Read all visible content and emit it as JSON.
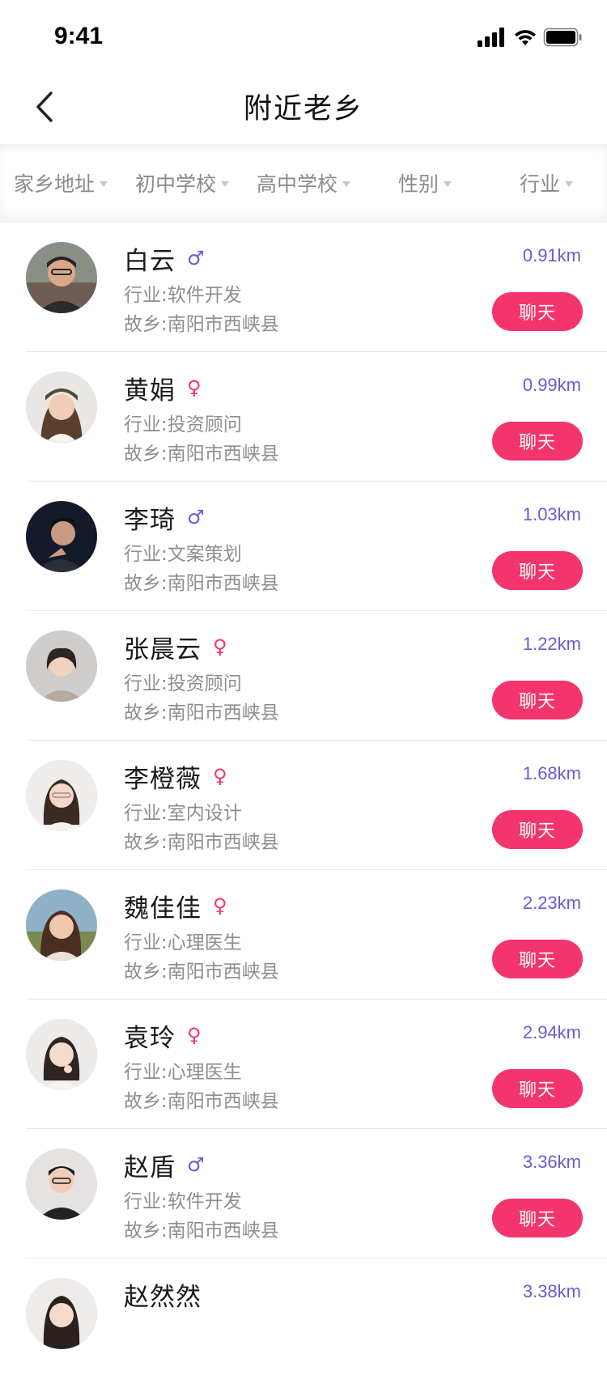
{
  "status_bar": {
    "time": "9:41"
  },
  "header": {
    "title": "附近老乡",
    "back_icon": "chevron-left-icon"
  },
  "filters": [
    "家乡地址",
    "初中学校",
    "高中学校",
    "性别",
    "行业"
  ],
  "chat_label": "聊天",
  "colors": {
    "accent": "#f4346c",
    "male": "#6a5bd0",
    "female": "#f0386b",
    "distance": "#6a5bd0"
  },
  "users": [
    {
      "name": "白云",
      "gender": "♂",
      "industry": "行业:软件开发",
      "hometown": "故乡:南阳市西峡县",
      "distance": "0.91km"
    },
    {
      "name": "黄娟",
      "gender": "♀",
      "industry": "行业:投资顾问",
      "hometown": "故乡:南阳市西峡县",
      "distance": "0.99km"
    },
    {
      "name": "李琦",
      "gender": "♂",
      "industry": "行业:文案策划",
      "hometown": "故乡:南阳市西峡县",
      "distance": "1.03km"
    },
    {
      "name": "张晨云",
      "gender": "♀",
      "industry": "行业:投资顾问",
      "hometown": "故乡:南阳市西峡县",
      "distance": "1.22km"
    },
    {
      "name": "李橙薇",
      "gender": "♀",
      "industry": "行业:室内设计",
      "hometown": "故乡:南阳市西峡县",
      "distance": "1.68km"
    },
    {
      "name": "魏佳佳",
      "gender": "♀",
      "industry": "行业:心理医生",
      "hometown": "故乡:南阳市西峡县",
      "distance": "2.23km"
    },
    {
      "name": "袁玲",
      "gender": "♀",
      "industry": "行业:心理医生",
      "hometown": "故乡:南阳市西峡县",
      "distance": "2.94km"
    },
    {
      "name": "赵盾",
      "gender": "♂",
      "industry": "行业:软件开发",
      "hometown": "故乡:南阳市西峡县",
      "distance": "3.36km"
    },
    {
      "name": "赵然然",
      "gender": "",
      "industry": "",
      "hometown": "",
      "distance": "3.38km"
    }
  ]
}
